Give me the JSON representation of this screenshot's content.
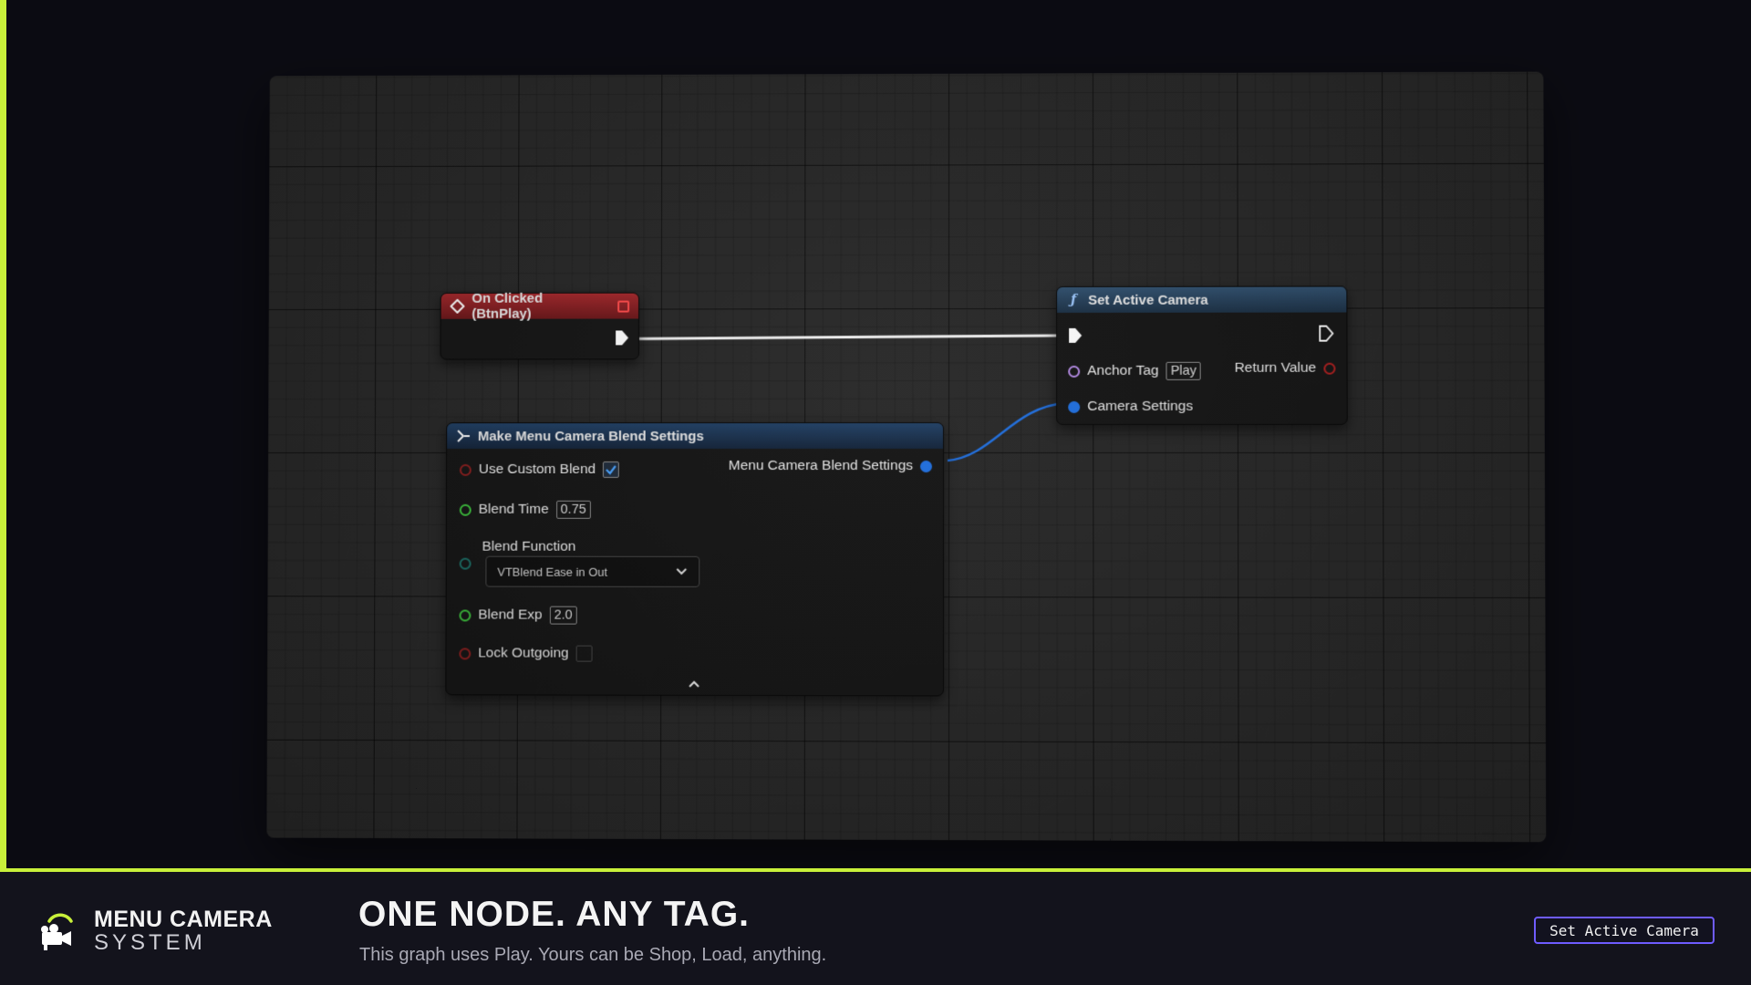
{
  "colors": {
    "accent": "#c8f03a",
    "exec_pin": "#ffffff",
    "bool_pin": "#8b1d1d",
    "float_pin": "#3cc23c",
    "enum_pin": "#1a8a7a",
    "struct_pin": "#1f6fe0",
    "name_pin": "#b58ae6",
    "button_border": "#6f5cff"
  },
  "graph": {
    "on_clicked": {
      "title": "On Clicked (BtnPlay)",
      "icon": "event-diamond-icon"
    },
    "set_active_camera": {
      "title": "Set Active Camera",
      "icon": "function-icon",
      "anchor_tag_label": "Anchor Tag",
      "anchor_tag_value": "Play",
      "return_value_label": "Return Value",
      "camera_settings_label": "Camera Settings"
    },
    "make_blend": {
      "title": "Make Menu Camera Blend Settings",
      "icon": "make-struct-icon",
      "use_custom_blend_label": "Use Custom Blend",
      "use_custom_blend_checked": true,
      "blend_time_label": "Blend Time",
      "blend_time_value": "0.75",
      "blend_function_label": "Blend Function",
      "blend_function_value": "VTBlend Ease in Out",
      "blend_exp_label": "Blend Exp",
      "blend_exp_value": "2.0",
      "lock_outgoing_label": "Lock Outgoing",
      "lock_outgoing_checked": false,
      "output_label": "Menu Camera Blend Settings"
    }
  },
  "footer": {
    "brand_line1": "MENU CAMERA",
    "brand_line2": "SYSTEM",
    "headline": "ONE NODE. ANY TAG.",
    "subline": "This graph uses Play. Yours can be Shop, Load, anything.",
    "tag_button": "Set Active Camera"
  }
}
